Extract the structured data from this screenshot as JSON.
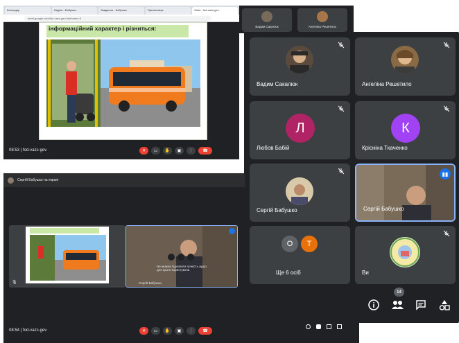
{
  "window1": {
    "tabs": [
      "Календар",
      "Неділя - Бабушко",
      "Завдання - Бабушко",
      "Презентація",
      "Meet - fod-vazc-gev"
    ],
    "url": "meet.google.com/fod-vazc-gev?authuser=0",
    "slide_title": "інформаційний характер і різниться:",
    "meeting_time": "08:53 | fod-vazc-gev"
  },
  "thumbs": [
    {
      "name": "Вадим Сакалюк"
    },
    {
      "name": "Ангеліна Решетило"
    }
  ],
  "panel": {
    "participants": [
      {
        "name": "Вадим Сакалюк"
      },
      {
        "name": "Ангеліна Решетило"
      },
      {
        "name": "Любов Бабій",
        "initial": "Л",
        "color": "#b02465"
      },
      {
        "name": "Крісніна Ткаченко",
        "initial": "К",
        "color": "#a142f4"
      },
      {
        "name": "Сергій Бабушко"
      },
      {
        "name": "Сергій Бабушко"
      },
      {
        "name": "Ще 6 осіб",
        "bubble_a": "О",
        "bubble_b": "Т"
      },
      {
        "name": "Ви"
      }
    ],
    "people_count": "14"
  },
  "window2": {
    "presenter": "Сергій Бабушко на екрані",
    "mini_caption": "Сергій Бабушко",
    "pip_text": "Не можна підсилити гучність аудіо для цього користувача",
    "meeting_time": "08:54 | fod-vazc-gev"
  },
  "colors": {
    "meet_bg": "#202124",
    "tile_bg": "#3c4043",
    "end_call": "#ea4335",
    "active_speaker": "#8ab4f8"
  }
}
